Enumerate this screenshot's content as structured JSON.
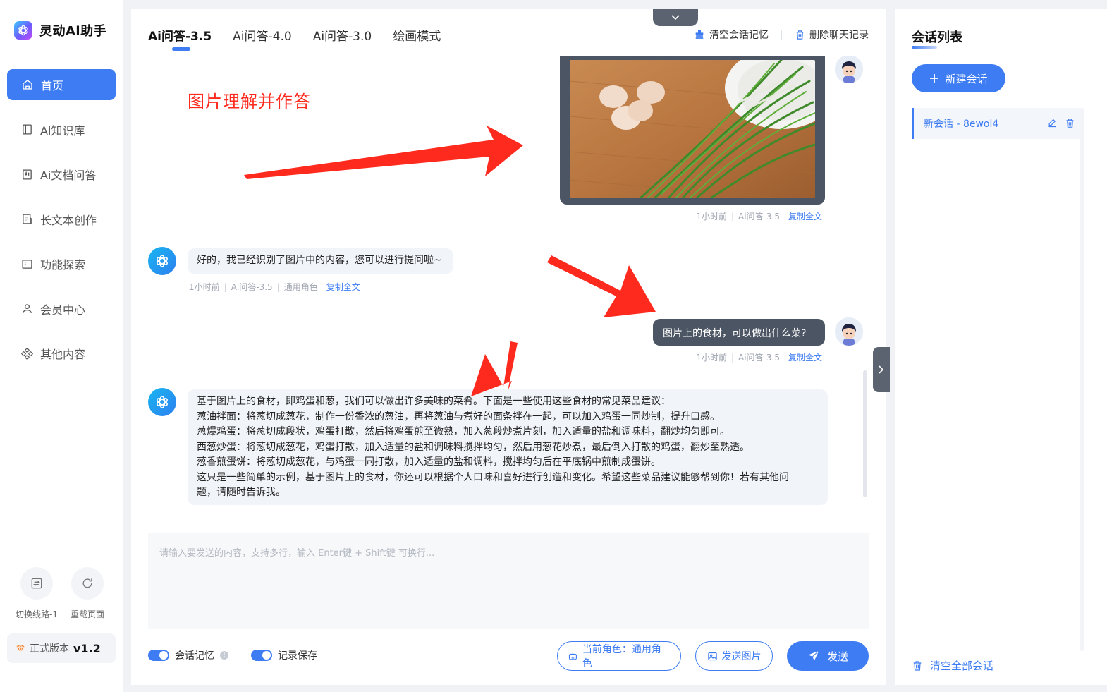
{
  "brand": {
    "name": "灵动Ai助手"
  },
  "sidebar": {
    "items": [
      {
        "label": "首页",
        "icon": "home-icon",
        "active": true
      },
      {
        "label": "Ai知识库",
        "icon": "book-icon",
        "active": false
      },
      {
        "label": "Ai文档问答",
        "icon": "ai-doc-icon",
        "active": false
      },
      {
        "label": "长文本创作",
        "icon": "document-icon",
        "active": false
      },
      {
        "label": "功能探索",
        "icon": "explore-icon",
        "active": false
      },
      {
        "label": "会员中心",
        "icon": "user-icon",
        "active": false
      },
      {
        "label": "其他内容",
        "icon": "grid-icon",
        "active": false
      }
    ],
    "tools": [
      {
        "label": "切换线路-1",
        "icon": "switch-line-icon"
      },
      {
        "label": "重载页面",
        "icon": "reload-icon"
      }
    ],
    "version_label": "正式版本",
    "version_number": "v1.2"
  },
  "tabs": [
    {
      "label": "Ai问答-3.5",
      "active": true
    },
    {
      "label": "Ai问答-4.0",
      "active": false
    },
    {
      "label": "Ai问答-3.0",
      "active": false
    },
    {
      "label": "绘画模式",
      "active": false
    }
  ],
  "header_actions": {
    "clear_memory": "清空会话记忆",
    "delete_history": "删除聊天记录"
  },
  "annotation": "图片理解并作答",
  "messages": [
    {
      "role": "user",
      "type": "image",
      "meta_time": "1小时前",
      "meta_model": "Ai问答-3.5",
      "copy": "复制全文"
    },
    {
      "role": "bot",
      "text": "好的，我已经识别了图片中的内容，您可以进行提问啦~",
      "meta_time": "1小时前",
      "meta_model": "Ai问答-3.5",
      "meta_role": "通用角色",
      "copy": "复制全文"
    },
    {
      "role": "user",
      "text": "图片上的食材，可以做出什么菜?",
      "meta_time": "1小时前",
      "meta_model": "Ai问答-3.5",
      "copy": "复制全文"
    },
    {
      "role": "bot",
      "lines": [
        "基于图片上的食材，即鸡蛋和葱，我们可以做出许多美味的菜肴。下面是一些使用这些食材的常见菜品建议：",
        "葱油拌面：将葱切成葱花，制作一份香浓的葱油，再将葱油与煮好的面条拌在一起，可以加入鸡蛋一同炒制，提升口感。",
        "葱爆鸡蛋：将葱切成段状，鸡蛋打散，然后将鸡蛋煎至微熟，加入葱段炒煮片刻，加入适量的盐和调味料，翻炒均匀即可。",
        "西葱炒蛋：将葱切成葱花，鸡蛋打散，加入适量的盐和调味料搅拌均匀，然后用葱花炒煮，最后倒入打散的鸡蛋，翻炒至熟透。",
        "葱香煎蛋饼：将葱切成葱花，与鸡蛋一同打散，加入适量的盐和调料，搅拌均匀后在平底锅中煎制成蛋饼。",
        "这只是一些简单的示例，基于图片上的食材，你还可以根据个人口味和喜好进行创造和变化。希望这些菜品建议能够帮到你！若有其他问",
        "题，请随时告诉我。"
      ]
    }
  ],
  "input": {
    "placeholder": "请输入要发送的内容，支持多行，输入 Enter键 + Shift键 可换行..."
  },
  "bottom": {
    "memory_label": "会话记忆",
    "save_label": "记录保存",
    "role_button": "当前角色：通用角色",
    "image_button": "发送图片",
    "send_button": "发送"
  },
  "right_panel": {
    "title": "会话列表",
    "new_chat": "新建会话",
    "sessions": [
      {
        "label": "新会话 - 8ewol4"
      }
    ],
    "clear_all": "清空全部会话"
  },
  "colors": {
    "accent": "#3d7cf2",
    "annotation": "#ff2a1e",
    "dark_bubble": "#4c5563"
  }
}
